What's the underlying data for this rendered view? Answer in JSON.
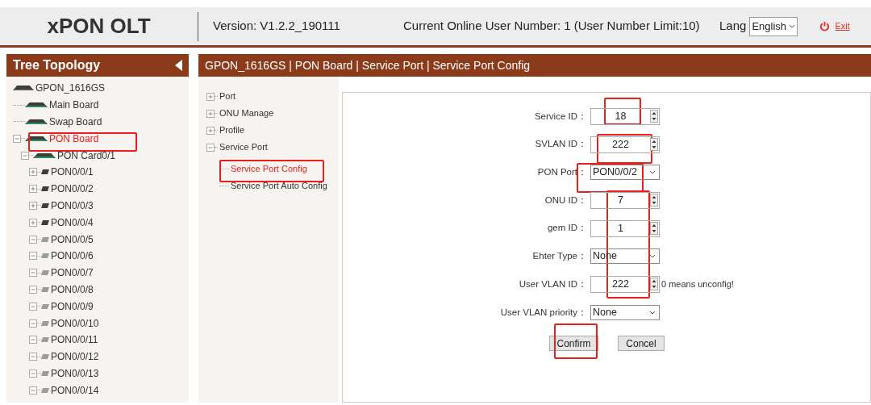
{
  "header": {
    "logo": "xPON OLT",
    "version": "Version: V1.2.2_190111",
    "online_users": "Current Online User Number: 1 (User Number Limit:10)",
    "lang_label": "Lang",
    "lang_value": "English",
    "exit": "Exit"
  },
  "sidebar": {
    "title": "Tree Topology",
    "tree": [
      {
        "label": "GPON_1616GS",
        "kind": "chassis",
        "selected": false,
        "children": [
          {
            "label": "Main Board",
            "kind": "board",
            "selected": false
          },
          {
            "label": "Swap Board",
            "kind": "board",
            "selected": false
          },
          {
            "label": "PON Board",
            "kind": "board",
            "selected": true,
            "expanded": true,
            "children": [
              {
                "label": "PON Card0/1",
                "kind": "board",
                "selected": false,
                "expanded": true,
                "children": [
                  {
                    "label": "PON0/0/1",
                    "kind": "port",
                    "active": true,
                    "selected": false,
                    "expanded": false
                  },
                  {
                    "label": "PON0/0/2",
                    "kind": "port",
                    "active": true,
                    "selected": false,
                    "expanded": false
                  },
                  {
                    "label": "PON0/0/3",
                    "kind": "port",
                    "active": true,
                    "selected": false,
                    "expanded": false
                  },
                  {
                    "label": "PON0/0/4",
                    "kind": "port",
                    "active": true,
                    "selected": false,
                    "expanded": false
                  },
                  {
                    "label": "PON0/0/5",
                    "kind": "port",
                    "active": false,
                    "selected": false,
                    "expanded": true
                  },
                  {
                    "label": "PON0/0/6",
                    "kind": "port",
                    "active": false,
                    "selected": false,
                    "expanded": true
                  },
                  {
                    "label": "PON0/0/7",
                    "kind": "port",
                    "active": false,
                    "selected": false,
                    "expanded": true
                  },
                  {
                    "label": "PON0/0/8",
                    "kind": "port",
                    "active": false,
                    "selected": false,
                    "expanded": true
                  },
                  {
                    "label": "PON0/0/9",
                    "kind": "port",
                    "active": false,
                    "selected": false,
                    "expanded": true
                  },
                  {
                    "label": "PON0/0/10",
                    "kind": "port",
                    "active": false,
                    "selected": false,
                    "expanded": true
                  },
                  {
                    "label": "PON0/0/11",
                    "kind": "port",
                    "active": false,
                    "selected": false,
                    "expanded": true
                  },
                  {
                    "label": "PON0/0/12",
                    "kind": "port",
                    "active": false,
                    "selected": false,
                    "expanded": true
                  },
                  {
                    "label": "PON0/0/13",
                    "kind": "port",
                    "active": false,
                    "selected": false,
                    "expanded": true
                  },
                  {
                    "label": "PON0/0/14",
                    "kind": "port",
                    "active": false,
                    "selected": false,
                    "expanded": true
                  }
                ]
              }
            ]
          }
        ]
      }
    ]
  },
  "breadcrumb": "GPON_1616GS | PON Board | Service Port | Service Port Config",
  "menu": [
    {
      "label": "Port",
      "expanded": false,
      "selected": false
    },
    {
      "label": "ONU Manage",
      "expanded": false,
      "selected": false
    },
    {
      "label": "Profile",
      "expanded": false,
      "selected": false
    },
    {
      "label": "Service Port",
      "expanded": true,
      "selected": false,
      "children": [
        {
          "label": "Service Port Config",
          "selected": true
        },
        {
          "label": "Service Port Auto Config",
          "selected": false
        }
      ]
    }
  ],
  "form": {
    "fields": [
      {
        "label": "Service ID：",
        "kind": "spinner",
        "value": "18"
      },
      {
        "label": "SVLAN ID：",
        "kind": "spinner",
        "value": "222"
      },
      {
        "label": "PON Port：",
        "kind": "select",
        "value": "PON0/0/2"
      },
      {
        "label": "ONU ID：",
        "kind": "spinner",
        "value": "7"
      },
      {
        "label": "gem ID：",
        "kind": "spinner",
        "value": "1"
      },
      {
        "label": "Ehter Type：",
        "kind": "select",
        "value": "None"
      },
      {
        "label": "User VLAN ID：",
        "kind": "spinner",
        "value": "222",
        "hint": "0 means unconfig!"
      },
      {
        "label": "User VLAN priority：",
        "kind": "select",
        "value": "None"
      }
    ],
    "buttons": [
      "Confirm",
      "Concel"
    ]
  }
}
